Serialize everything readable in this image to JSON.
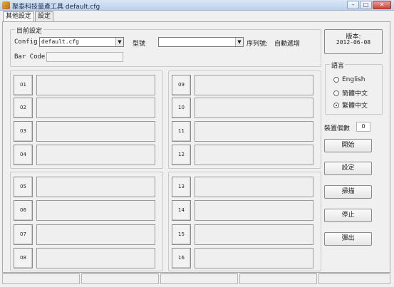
{
  "window": {
    "title": "聚泰科技量產工具 default.cfg",
    "minimize": "–",
    "maximize": "□",
    "close": "✕"
  },
  "tabs": [
    {
      "label": "其他設定"
    },
    {
      "label": "設定"
    }
  ],
  "current_settings": {
    "legend": "目前設定",
    "config_label": "Config",
    "config_value": "default.cfg",
    "model_label": "型號",
    "model_value": "",
    "serial_label": "序列號:",
    "serial_value": "自動遞增",
    "barcode_label": "Bar Code",
    "barcode_value": ""
  },
  "version": {
    "label": "版本:",
    "date": "2012-06-08"
  },
  "language": {
    "legend": "語言",
    "options": [
      {
        "label": "English",
        "selected": false
      },
      {
        "label": "簡體中文",
        "selected": false
      },
      {
        "label": "繁體中文",
        "selected": true
      }
    ]
  },
  "device_count": {
    "label": "裝置個數",
    "value": "0"
  },
  "actions": {
    "start": "開始",
    "settings": "設定",
    "scan": "掃描",
    "stop": "停止",
    "eject": "彈出"
  },
  "slots": [
    "01",
    "02",
    "03",
    "04",
    "05",
    "06",
    "07",
    "08",
    "09",
    "10",
    "11",
    "12",
    "13",
    "14",
    "15",
    "16"
  ],
  "colors": {
    "title_bar": "#bcd1ea",
    "window_bg": "#f0f0f0",
    "close_button": "#c5493a"
  }
}
